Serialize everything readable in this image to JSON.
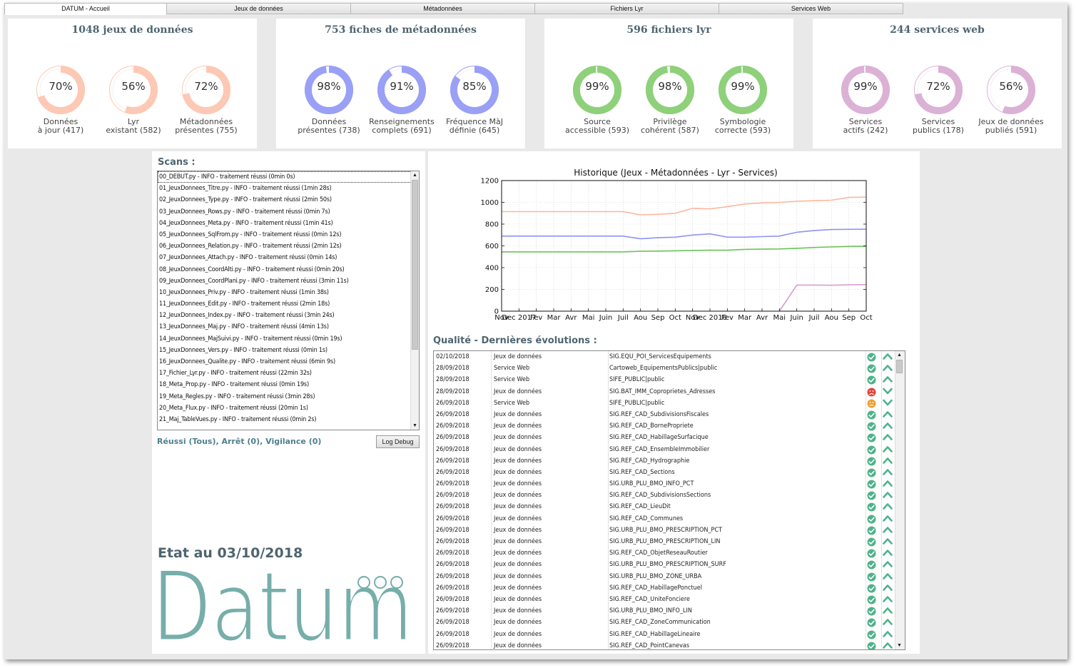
{
  "tabs": [
    "DATUM - Accueil",
    "Jeux de données",
    "Métadonnées",
    "Fichiers Lyr",
    "Services Web"
  ],
  "active_tab": 0,
  "cards": [
    {
      "title": "1048 jeux de données",
      "color": "#fdc9b4",
      "gauges": [
        {
          "pct": 70,
          "text": "70%",
          "l1": "Données",
          "l2": "à jour (417)"
        },
        {
          "pct": 56,
          "text": "56%",
          "l1": "Lyr",
          "l2": "existant (582)"
        },
        {
          "pct": 72,
          "text": "72%",
          "l1": "Métadonnées",
          "l2": "présentes (755)"
        }
      ]
    },
    {
      "title": "753 fiches de métadonnées",
      "color": "#9aa0f6",
      "gauges": [
        {
          "pct": 98,
          "text": "98%",
          "l1": "Données",
          "l2": "présentes (738)"
        },
        {
          "pct": 91,
          "text": "91%",
          "l1": "Renseignements",
          "l2": "complets (691)"
        },
        {
          "pct": 85,
          "text": "85%",
          "l1": "Fréquence MàJ",
          "l2": "définie (645)"
        }
      ]
    },
    {
      "title": "596 fichiers lyr",
      "color": "#8fd07b",
      "gauges": [
        {
          "pct": 99,
          "text": "99%",
          "l1": "Source",
          "l2": "accessible (593)"
        },
        {
          "pct": 98,
          "text": "98%",
          "l1": "Privilège",
          "l2": "cohérent (587)"
        },
        {
          "pct": 99,
          "text": "99%",
          "l1": "Symbologie",
          "l2": "correcte (593)"
        }
      ]
    },
    {
      "title": "244 services web",
      "color": "#dcb1d6",
      "gauges": [
        {
          "pct": 99,
          "text": "99%",
          "l1": "Services",
          "l2": "actifs (242)"
        },
        {
          "pct": 72,
          "text": "72%",
          "l1": "Services",
          "l2": "publics (178)"
        },
        {
          "pct": 56,
          "text": "56%",
          "l1": "Jeux de données",
          "l2": "publiés (591)"
        }
      ]
    }
  ],
  "scans": {
    "title": "Scans :",
    "rows": [
      "00_DEBUT.py - INFO - traitement réussi (0min 0s)",
      "01_JeuxDonnees_Titre.py - INFO - traitement réussi (1min 28s)",
      "02_JeuxDonnees_Type.py - INFO - traitement réussi (2min 50s)",
      "03_JeuxDonnees_Rows.py - INFO - traitement réussi (0min 7s)",
      "04_JeuxDonnees_Meta.py - INFO - traitement réussi (1min 41s)",
      "05_JeuxDonnees_SqlFrom.py - INFO - traitement réussi (0min 12s)",
      "06_JeuxDonnees_Relation.py - INFO - traitement réussi (2min 12s)",
      "07_JeuxDonnees_Attach.py - INFO - traitement réussi (0min 14s)",
      "08_JeuxDonnees_CoordAlti.py - INFO - traitement réussi (0min 20s)",
      "09_JeuxDonnees_CoordPlani.py - INFO - traitement réussi (3min 11s)",
      "10_JeuxDonnees_Priv.py - INFO - traitement réussi (1min 38s)",
      "11_JeuxDonnees_Edit.py - INFO - traitement réussi (2min 18s)",
      "12_JeuxDonnees_Index.py - INFO - traitement réussi (3min 24s)",
      "13_JeuxDonnees_Maj.py - INFO - traitement réussi (4min 13s)",
      "14_JeuxDonnees_MajSuivi.py - INFO - traitement réussi (0min 19s)",
      "15_JeuxDonnees_Vers.py - INFO - traitement réussi (0min 1s)",
      "16_JeuxDonnees_Qualite.py - INFO - traitement réussi (6min 9s)",
      "17_Fichier_Lyr.py - INFO - traitement réussi (22min 32s)",
      "18_Meta_Prop.py - INFO - traitement réussi (0min 19s)",
      "19_Meta_Regles.py - INFO - traitement réussi (3min 28s)",
      "20_Meta_Flux.py - INFO - traitement réussi (20min 1s)",
      "21_Maj_TableVues.py - INFO - traitement réussi (0min 2s)"
    ],
    "status": "Réussi (Tous), Arrêt (0), Vigilance (0)",
    "log_button": "Log Debug"
  },
  "etat": "Etat au 03/10/2018",
  "logo_text": "Datum",
  "chart_data": {
    "type": "line",
    "title": "Historique (Jeux - Métadonnées - Lyr - Services)",
    "categories": [
      "Nov",
      "Dec 2017",
      "Fev",
      "Mar",
      "Avr",
      "Mai",
      "Juin",
      "Juil",
      "Aou",
      "Sep",
      "Oct",
      "Nov",
      "Dec 2018",
      "Fev",
      "Mar",
      "Avr",
      "Mai",
      "Juin",
      "Juil",
      "Aou",
      "Sep",
      "Oct"
    ],
    "ylim": [
      0,
      1200
    ],
    "yticks": [
      0,
      200,
      400,
      600,
      800,
      1000,
      1200
    ],
    "grid": true,
    "series": [
      {
        "color": "#fdb69c",
        "values": [
          915,
          915,
          915,
          915,
          915,
          915,
          915,
          915,
          885,
          890,
          900,
          945,
          940,
          960,
          985,
          995,
          1000,
          1010,
          1015,
          1020,
          1045,
          1048
        ]
      },
      {
        "color": "#8f93f4",
        "values": [
          690,
          690,
          690,
          690,
          690,
          690,
          690,
          690,
          665,
          675,
          680,
          700,
          710,
          680,
          680,
          685,
          690,
          725,
          740,
          750,
          752,
          753
        ]
      },
      {
        "color": "#6cc25a",
        "values": [
          545,
          545,
          545,
          545,
          545,
          545,
          545,
          545,
          550,
          552,
          555,
          558,
          560,
          560,
          568,
          570,
          572,
          578,
          585,
          590,
          595,
          596
        ]
      },
      {
        "color": "#d79fd1",
        "values": [
          null,
          null,
          null,
          null,
          null,
          null,
          null,
          null,
          null,
          null,
          null,
          null,
          null,
          null,
          null,
          null,
          0,
          240,
          240,
          238,
          243,
          244
        ]
      }
    ]
  },
  "qualite": {
    "title": "Qualité - Dernières évolutions :",
    "rows": [
      {
        "date": "02/10/2018",
        "type": "Jeux de données",
        "name": "SIG.EQU_POI_ServicesEquipements",
        "status": "ok",
        "trend": "up"
      },
      {
        "date": "28/09/2018",
        "type": "Service Web",
        "name": "Cartoweb_EquipementsPublics|public",
        "status": "ok",
        "trend": "up"
      },
      {
        "date": "28/09/2018",
        "type": "Service Web",
        "name": "SIFE_PUBLIC|public",
        "status": "ok",
        "trend": "up"
      },
      {
        "date": "28/09/2018",
        "type": "Jeux de données",
        "name": "SIG.BAT_IMM_Coproprietes_Adresses",
        "status": "bad",
        "trend": "down"
      },
      {
        "date": "26/09/2018",
        "type": "Service Web",
        "name": "SIFE_PUBLIC|public",
        "status": "warn",
        "trend": "down"
      },
      {
        "date": "26/09/2018",
        "type": "Jeux de données",
        "name": "SIG.REF_CAD_SubdivisionsFiscales",
        "status": "ok",
        "trend": "up"
      },
      {
        "date": "26/09/2018",
        "type": "Jeux de données",
        "name": "SIG.REF_CAD_BornePropriete",
        "status": "ok",
        "trend": "up"
      },
      {
        "date": "26/09/2018",
        "type": "Jeux de données",
        "name": "SIG.REF_CAD_HabillageSurfacique",
        "status": "ok",
        "trend": "up"
      },
      {
        "date": "26/09/2018",
        "type": "Jeux de données",
        "name": "SIG.REF_CAD_EnsembleImmobilier",
        "status": "ok",
        "trend": "up"
      },
      {
        "date": "26/09/2018",
        "type": "Jeux de données",
        "name": "SIG.REF_CAD_Hydrographie",
        "status": "ok",
        "trend": "up"
      },
      {
        "date": "26/09/2018",
        "type": "Jeux de données",
        "name": "SIG.REF_CAD_Sections",
        "status": "ok",
        "trend": "up"
      },
      {
        "date": "26/09/2018",
        "type": "Jeux de données",
        "name": "SIG.URB_PLU_BMO_INFO_PCT",
        "status": "ok",
        "trend": "up"
      },
      {
        "date": "26/09/2018",
        "type": "Jeux de données",
        "name": "SIG.REF_CAD_SubdivisionsSections",
        "status": "ok",
        "trend": "up"
      },
      {
        "date": "26/09/2018",
        "type": "Jeux de données",
        "name": "SIG.REF_CAD_LieuDit",
        "status": "ok",
        "trend": "up"
      },
      {
        "date": "26/09/2018",
        "type": "Jeux de données",
        "name": "SIG.REF_CAD_Communes",
        "status": "ok",
        "trend": "up"
      },
      {
        "date": "26/09/2018",
        "type": "Jeux de données",
        "name": "SIG.URB_PLU_BMO_PRESCRIPTION_PCT",
        "status": "ok",
        "trend": "up"
      },
      {
        "date": "26/09/2018",
        "type": "Jeux de données",
        "name": "SIG.URB_PLU_BMO_PRESCRIPTION_LIN",
        "status": "ok",
        "trend": "up"
      },
      {
        "date": "26/09/2018",
        "type": "Jeux de données",
        "name": "SIG.REF_CAD_ObjetReseauRoutier",
        "status": "ok",
        "trend": "up"
      },
      {
        "date": "26/09/2018",
        "type": "Jeux de données",
        "name": "SIG.URB_PLU_BMO_PRESCRIPTION_SURF",
        "status": "ok",
        "trend": "up"
      },
      {
        "date": "26/09/2018",
        "type": "Jeux de données",
        "name": "SIG.URB_PLU_BMO_ZONE_URBA",
        "status": "ok",
        "trend": "up"
      },
      {
        "date": "26/09/2018",
        "type": "Jeux de données",
        "name": "SIG.REF_CAD_HabillagePonctuel",
        "status": "ok",
        "trend": "up"
      },
      {
        "date": "26/09/2018",
        "type": "Jeux de données",
        "name": "SIG.REF_CAD_UniteFonciere",
        "status": "ok",
        "trend": "up"
      },
      {
        "date": "26/09/2018",
        "type": "Jeux de données",
        "name": "SIG.URB_PLU_BMO_INFO_LIN",
        "status": "ok",
        "trend": "up"
      },
      {
        "date": "26/09/2018",
        "type": "Jeux de données",
        "name": "SIG.REF_CAD_ZoneCommunication",
        "status": "ok",
        "trend": "up"
      },
      {
        "date": "26/09/2018",
        "type": "Jeux de données",
        "name": "SIG.REF_CAD_HabillageLineaire",
        "status": "ok",
        "trend": "up"
      },
      {
        "date": "26/09/2018",
        "type": "Jeux de données",
        "name": "SIG.REF_CAD_PointCanevas",
        "status": "ok",
        "trend": "up"
      }
    ]
  },
  "colors": {
    "ok": "#4fb28d",
    "bad": "#e0453a",
    "warn": "#f0a030",
    "trend": "#4fb28d",
    "accent": "#4e6570",
    "logo": "#76aeaa"
  }
}
